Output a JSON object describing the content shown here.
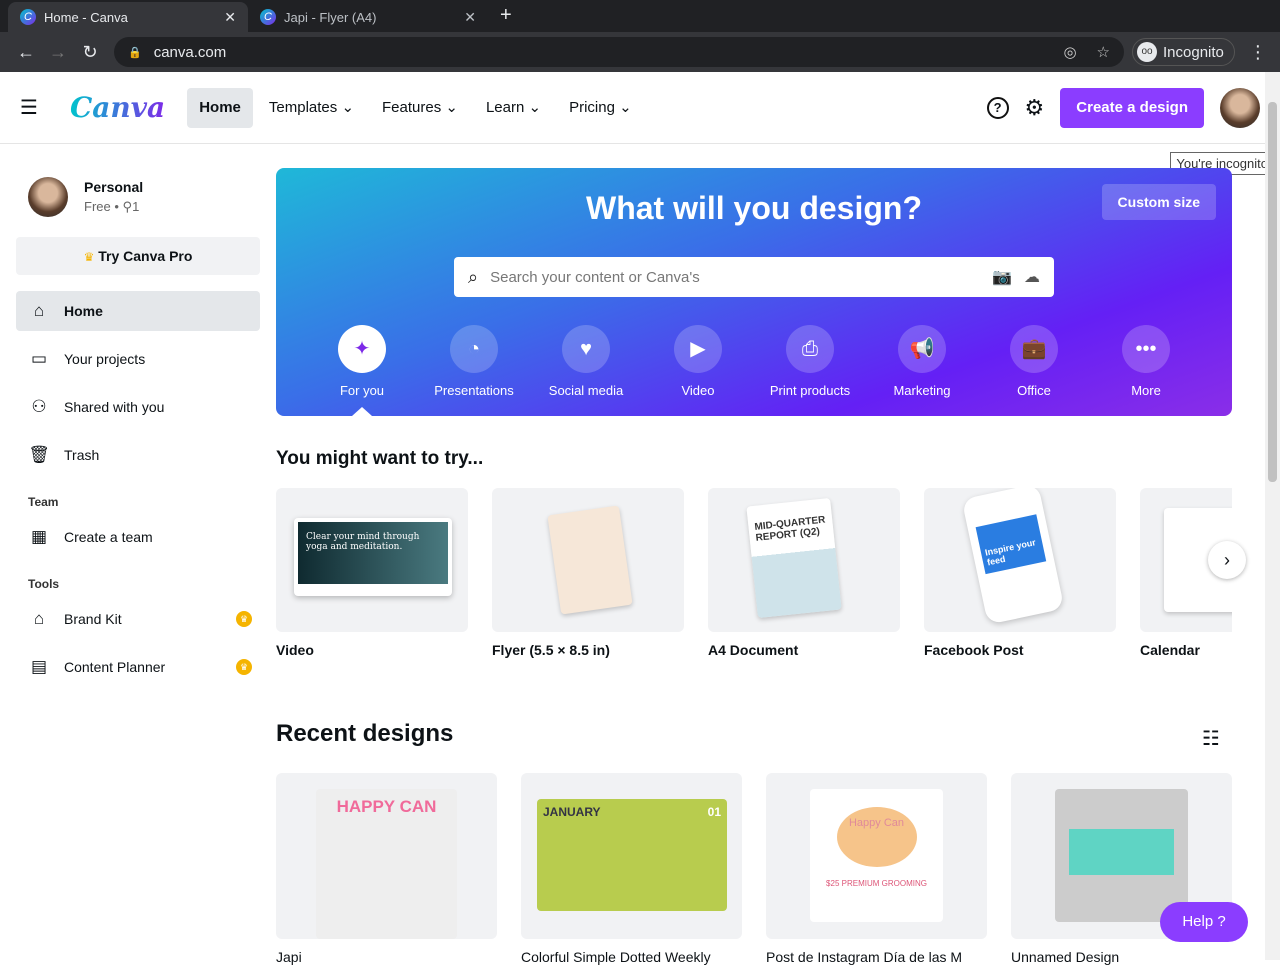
{
  "browser": {
    "tabs": [
      {
        "title": "Home - Canva",
        "active": true
      },
      {
        "title": "Japi - Flyer (A4)",
        "active": false
      }
    ],
    "url": "canva.com",
    "profile": "Incognito",
    "tooltip": "You're incognito"
  },
  "header": {
    "logo": "Canva",
    "nav": [
      "Home",
      "Templates",
      "Features",
      "Learn",
      "Pricing"
    ],
    "create_label": "Create a design",
    "accent": "#8b3dff"
  },
  "sidebar": {
    "account": "Personal",
    "plan": "Free •",
    "members": "1",
    "try_pro": "Try Canva Pro",
    "items": [
      {
        "label": "Home",
        "icon": "home-icon"
      },
      {
        "label": "Your projects",
        "icon": "folder-icon"
      },
      {
        "label": "Shared with you",
        "icon": "shared-users-icon"
      },
      {
        "label": "Trash",
        "icon": "trash-icon"
      }
    ],
    "team_heading": "Team",
    "team_items": [
      {
        "label": "Create a team",
        "icon": "building-icon"
      }
    ],
    "tools_heading": "Tools",
    "tools_items": [
      {
        "label": "Brand Kit",
        "icon": "brand-kit-icon"
      },
      {
        "label": "Content Planner",
        "icon": "calendar-icon"
      }
    ]
  },
  "banner": {
    "title": "What will you design?",
    "custom_size": "Custom size",
    "search_placeholder": "Search your content or Canva's",
    "categories": [
      "For you",
      "Presentations",
      "Social media",
      "Video",
      "Print products",
      "Marketing",
      "Office",
      "More"
    ]
  },
  "try_section": {
    "title": "You might want to try...",
    "items": [
      "Video",
      "Flyer (5.5 × 8.5 in)",
      "A4 Document",
      "Facebook Post",
      "Calendar"
    ]
  },
  "recent": {
    "title": "Recent designs",
    "items": [
      "Japi",
      "Colorful Simple Dotted Weekly",
      "Post de Instagram Día de las M",
      "Unnamed Design"
    ],
    "thumb_texts": [
      "HAPPY CAN",
      "JANUARY",
      "01",
      "Happy Can",
      "$25 PREMIUM GROOMING"
    ]
  },
  "try_thumb_texts": {
    "video": "Clear your mind through yoga and meditation.",
    "doc": "MID-QUARTER REPORT (Q2)",
    "fb": "Inspire your feed"
  },
  "help": "Help ?"
}
